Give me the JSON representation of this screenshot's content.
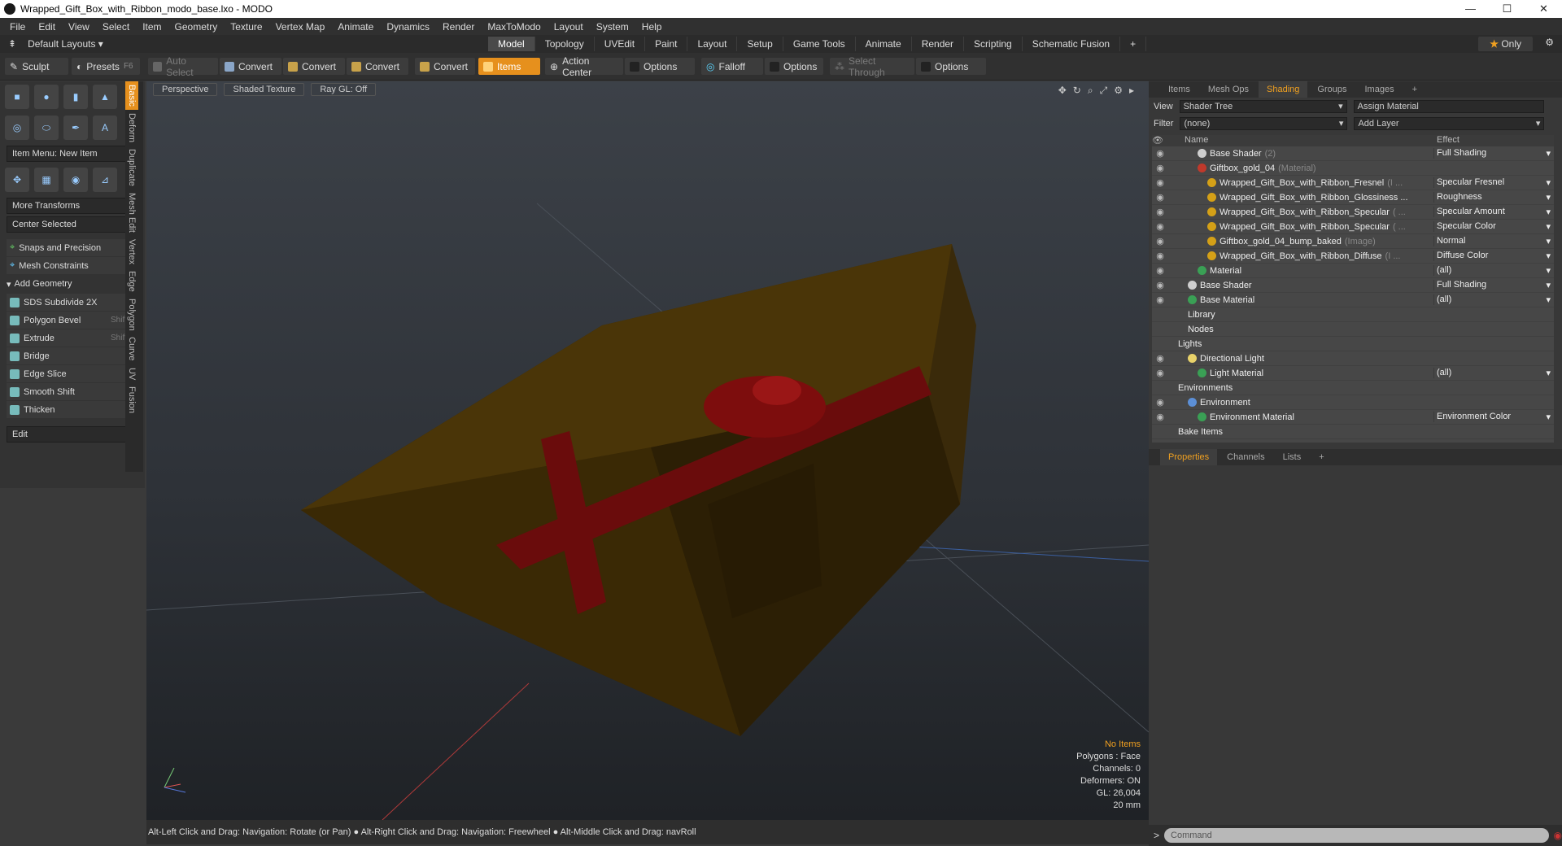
{
  "window": {
    "title": "Wrapped_Gift_Box_with_Ribbon_modo_base.lxo - MODO",
    "controls": [
      "—",
      "☐",
      "✕"
    ]
  },
  "menu": [
    "File",
    "Edit",
    "View",
    "Select",
    "Item",
    "Geometry",
    "Texture",
    "Vertex Map",
    "Animate",
    "Dynamics",
    "Render",
    "MaxToModo",
    "Layout",
    "System",
    "Help"
  ],
  "layout": {
    "selector": "Default Layouts ▾",
    "tabs": [
      "Model",
      "Topology",
      "UVEdit",
      "Paint",
      "Layout",
      "Setup",
      "Game Tools",
      "Animate",
      "Render",
      "Scripting",
      "Schematic Fusion",
      "+"
    ],
    "active_tab": "Model",
    "only_label": "Only"
  },
  "toolbar": {
    "sculpt": "Sculpt",
    "presets": "Presets",
    "presets_key": "F6",
    "auto_select": "Auto Select",
    "convert": "Convert",
    "items": "Items",
    "action_center": "Action Center",
    "options": "Options",
    "falloff": "Falloff",
    "select_through": "Select Through"
  },
  "left": {
    "item_menu": "Item Menu: New Item",
    "more_transforms": "More Transforms",
    "center_selected": "Center Selected",
    "snaps": "Snaps and Precision",
    "mesh_constraints": "Mesh Constraints",
    "add_geometry": "Add Geometry",
    "tools": [
      {
        "label": "SDS Subdivide 2X",
        "key": ""
      },
      {
        "label": "Polygon Bevel",
        "key": "Shift-B"
      },
      {
        "label": "Extrude",
        "key": "Shift-X"
      },
      {
        "label": "Bridge",
        "key": ""
      },
      {
        "label": "Edge Slice",
        "key": ""
      },
      {
        "label": "Smooth Shift",
        "key": ""
      },
      {
        "label": "Thicken",
        "key": ""
      }
    ],
    "edit": "Edit",
    "vtabs": [
      "Basic",
      "Deform",
      "Duplicate",
      "Mesh Edit",
      "Vertex",
      "Edge",
      "Polygon",
      "Curve",
      "UV",
      "Fusion"
    ]
  },
  "viewport": {
    "tabs": [
      "Perspective",
      "Shaded Texture",
      "Ray GL: Off"
    ],
    "stats": [
      "No Items",
      "Polygons : Face",
      "Channels: 0",
      "Deformers: ON",
      "GL: 26,004",
      "20 mm"
    ]
  },
  "status": "Alt-Left Click and Drag: Navigation: Rotate (or Pan) ● Alt-Right Click and Drag: Navigation: Freewheel ● Alt-Middle Click and Drag: navRoll",
  "right": {
    "tabs": [
      "Items",
      "Mesh Ops",
      "Shading",
      "Groups",
      "Images",
      "+"
    ],
    "active_tab": "Shading",
    "view_label": "View",
    "view_value": "Shader Tree",
    "assign_material": "Assign Material",
    "filter_label": "Filter",
    "filter_value": "(none)",
    "add_layer": "Add Layer",
    "col_name": "Name",
    "col_effect": "Effect",
    "rows": [
      {
        "name": "Base Shader",
        "suffix": "(2)",
        "effect": "Full Shading",
        "indent": 3,
        "color": "#cfcfcf"
      },
      {
        "name": "Giftbox_gold_04",
        "suffix": "(Material)",
        "effect": "",
        "indent": 3,
        "color": "#c0392b"
      },
      {
        "name": "Wrapped_Gift_Box_with_Ribbon_Fresnel",
        "suffix": "(I ...",
        "effect": "Specular Fresnel",
        "indent": 4,
        "color": "#d4a017"
      },
      {
        "name": "Wrapped_Gift_Box_with_Ribbon_Glossiness ...",
        "suffix": "",
        "effect": "Roughness",
        "indent": 4,
        "color": "#d4a017"
      },
      {
        "name": "Wrapped_Gift_Box_with_Ribbon_Specular",
        "suffix": "( ...",
        "effect": "Specular Amount",
        "indent": 4,
        "color": "#d4a017"
      },
      {
        "name": "Wrapped_Gift_Box_with_Ribbon_Specular",
        "suffix": "( ...",
        "effect": "Specular Color",
        "indent": 4,
        "color": "#d4a017"
      },
      {
        "name": "Giftbox_gold_04_bump_baked",
        "suffix": "(Image)",
        "effect": "Normal",
        "indent": 4,
        "color": "#d4a017"
      },
      {
        "name": "Wrapped_Gift_Box_with_Ribbon_Diffuse",
        "suffix": "(I ...",
        "effect": "Diffuse Color",
        "indent": 4,
        "color": "#d4a017"
      },
      {
        "name": "Material",
        "suffix": "",
        "effect": "(all)",
        "indent": 3,
        "color": "#3aa055"
      },
      {
        "name": "Base Shader",
        "suffix": "",
        "effect": "Full Shading",
        "indent": 2,
        "color": "#cfcfcf"
      },
      {
        "name": "Base Material",
        "suffix": "",
        "effect": "(all)",
        "indent": 2,
        "color": "#3aa055"
      },
      {
        "name": "Library",
        "suffix": "",
        "effect": "",
        "indent": 2,
        "color": ""
      },
      {
        "name": "Nodes",
        "suffix": "",
        "effect": "",
        "indent": 2,
        "color": ""
      },
      {
        "name": "Lights",
        "suffix": "",
        "effect": "",
        "indent": 1,
        "color": ""
      },
      {
        "name": "Directional Light",
        "suffix": "",
        "effect": "",
        "indent": 2,
        "color": "#e8d26a"
      },
      {
        "name": "Light Material",
        "suffix": "",
        "effect": "(all)",
        "indent": 3,
        "color": "#3aa055"
      },
      {
        "name": "Environments",
        "suffix": "",
        "effect": "",
        "indent": 1,
        "color": ""
      },
      {
        "name": "Environment",
        "suffix": "",
        "effect": "",
        "indent": 2,
        "color": "#5c8fd6"
      },
      {
        "name": "Environment Material",
        "suffix": "",
        "effect": "Environment Color",
        "indent": 3,
        "color": "#3aa055"
      },
      {
        "name": "Bake Items",
        "suffix": "",
        "effect": "",
        "indent": 1,
        "color": ""
      }
    ],
    "prop_tabs": [
      "Properties",
      "Channels",
      "Lists",
      "+"
    ],
    "command_placeholder": "Command"
  },
  "colors": {
    "accent": "#e6901d",
    "viewport_top": "#3c4148",
    "viewport_bottom": "#1f2226"
  }
}
